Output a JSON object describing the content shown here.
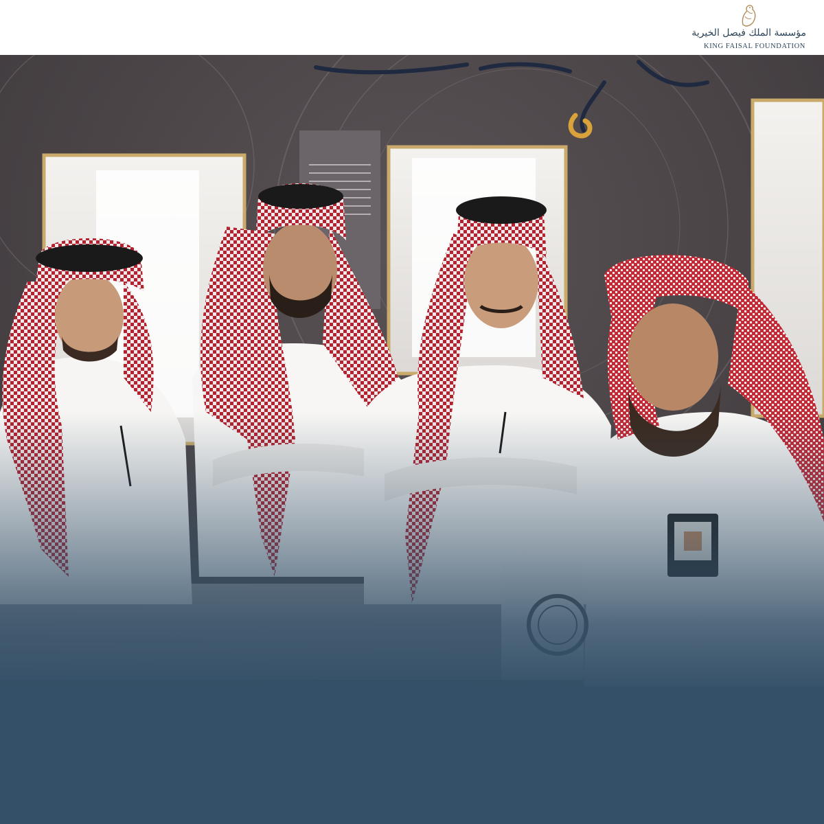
{
  "logo": {
    "arabic_text": "مؤسسة الملك فيصل الخيرية",
    "english_text": "KING FAISAL FOUNDATION"
  },
  "photo": {
    "subject": "four-men-at-exhibition-display-case"
  },
  "colors": {
    "header_background": "#ffffff",
    "overlay": "#345068",
    "logo_text": "#2b4358",
    "logo_gold": "#b08a55"
  }
}
